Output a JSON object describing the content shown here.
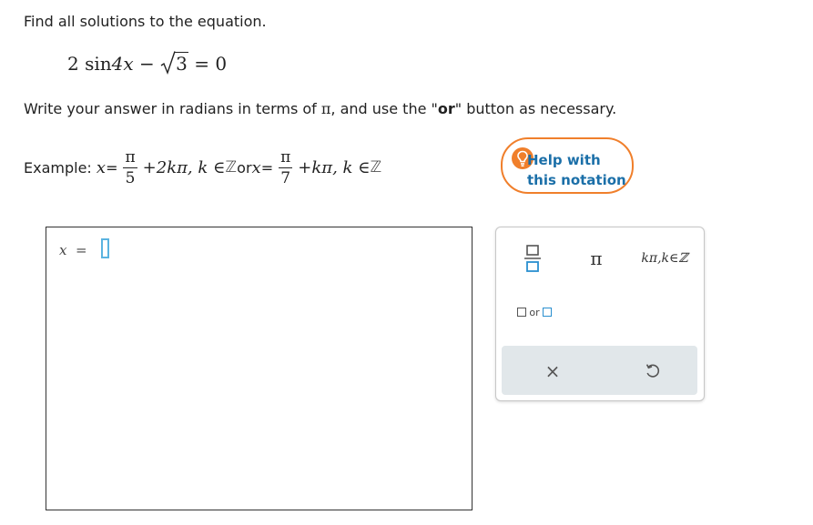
{
  "question": {
    "prompt": "Find all solutions to the equation.",
    "equation": {
      "coef": "2",
      "func": "sin",
      "arg": "4x",
      "minus": "−",
      "radicand": "3",
      "rhs": "= 0"
    },
    "instruction_parts": [
      "Write your answer in radians in terms of ",
      "π",
      ", and use the \"",
      "or",
      "\" button as necessary."
    ]
  },
  "example": {
    "label": "Example:",
    "var": "x",
    "eq": " = ",
    "frac1": {
      "num": "π",
      "den": "5"
    },
    "term1": "+2kπ, k ∈ ",
    "set": "ℤ",
    "or": " or ",
    "frac2": {
      "num": "π",
      "den": "7"
    },
    "term2": "+kπ, k ∈ "
  },
  "help": {
    "line1": "Help with",
    "line2": "this notation",
    "accent_color": "#f07f2b",
    "text_color": "#1b6fa8"
  },
  "answer": {
    "variable": "x",
    "equals": "=",
    "value": ""
  },
  "palette": {
    "fraction_icon": "fraction-template-icon",
    "pi_label": "π",
    "kpi_label": "kπ,k∈ℤ",
    "or_label": "or",
    "clear_icon": "×",
    "undo_icon": "undo-icon"
  }
}
